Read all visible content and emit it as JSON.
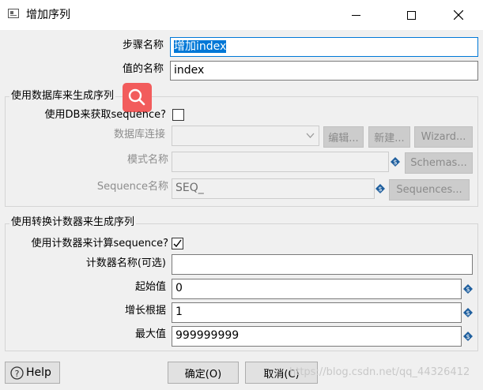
{
  "window": {
    "title": "增加序列",
    "minimize_icon": "minimize-icon",
    "maximize_icon": "maximize-icon",
    "close_icon": "close-icon"
  },
  "step_name": {
    "label": "步骤名称",
    "value": "增加index"
  },
  "value_name": {
    "label": "值的名称",
    "value": "index"
  },
  "db_group": {
    "title": "使用数据库来生成序列",
    "use_db": {
      "label": "使用DB来获取sequence?",
      "checked": false
    },
    "connection": {
      "label": "数据库连接",
      "value": ""
    },
    "edit_button": "编辑...",
    "new_button": "新建...",
    "wizard_button": "Wizard...",
    "schema": {
      "label": "模式名称",
      "value": ""
    },
    "schemas_button": "Schemas...",
    "sequence": {
      "label": "Sequence名称",
      "value": "SEQ_"
    },
    "sequences_button": "Sequences..."
  },
  "counter_group": {
    "title": "使用转换计数器来生成序列",
    "use_counter": {
      "label": "使用计数器来计算sequence?",
      "checked": true
    },
    "counter_name": {
      "label": "计数器名称(可选)",
      "value": ""
    },
    "start": {
      "label": "起始值",
      "value": "0"
    },
    "increment": {
      "label": "增长根据",
      "value": "1"
    },
    "max": {
      "label": "最大值",
      "value": "999999999"
    }
  },
  "footer": {
    "help_button": "Help",
    "ok_button": "确定(O)",
    "cancel_button": "取消(C)",
    "watermark": "https://blog.csdn.net/qq_44326412"
  },
  "colors": {
    "accent": "#0078d7",
    "search_badge": "#f25c5c",
    "variable_icon": "#1f5f9e"
  },
  "icons": {
    "app": "dialog-icon",
    "search": "search-icon",
    "variable": "variable-diamond-icon",
    "help": "help-icon",
    "dropdown": "chevron-down-icon",
    "check": "checkmark-icon"
  }
}
